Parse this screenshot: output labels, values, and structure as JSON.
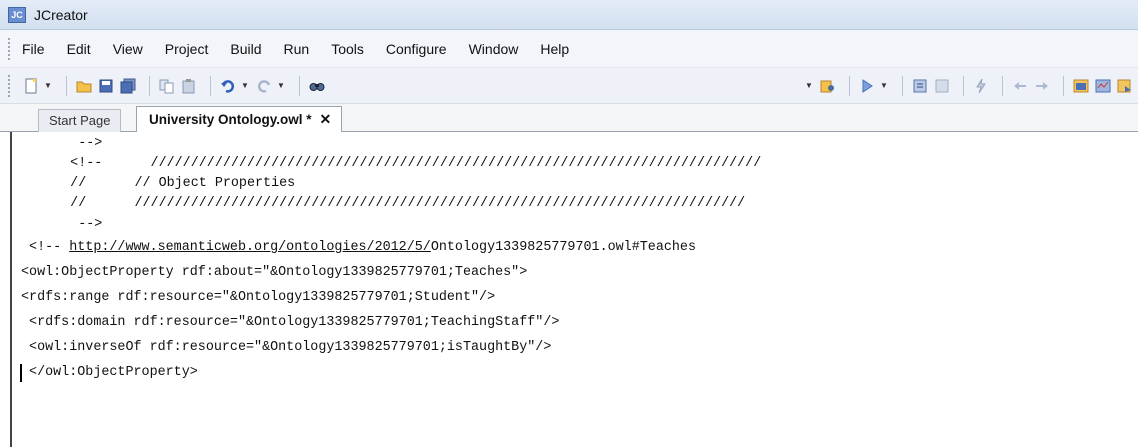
{
  "window": {
    "title": "JCreator"
  },
  "menu": {
    "items": [
      "File",
      "Edit",
      "View",
      "Project",
      "Build",
      "Run",
      "Tools",
      "Configure",
      "Window",
      "Help"
    ]
  },
  "toolbar": {
    "icons": [
      "new-file-icon",
      "open-folder-icon",
      "save-icon",
      "save-all-icon",
      "copy-icon",
      "paste-icon",
      "undo-icon",
      "redo-icon",
      "find-icon",
      "find-in-files-icon",
      "run-icon",
      "compile-icon",
      "build-icon",
      "debug-icon",
      "back-icon",
      "forward-icon",
      "window-icon"
    ]
  },
  "tabs": {
    "start": "Start Page",
    "active": "University Ontology.owl *",
    "close": "✕"
  },
  "editor": {
    "lines": [
      "      -->",
      "     <!--      ////////////////////////////////////////////////////////////////////////////",
      "     //      // Object Properties",
      "     //      ////////////////////////////////////////////////////////////////////////////",
      "      -->",
      "",
      "<owl:ObjectProperty rdf:about=\"&Ontology1339825779701;Teaches\">",
      "<rdfs:range rdf:resource=\"&Ontology1339825779701;Student\"/>",
      " <rdfs:domain rdf:resource=\"&Ontology1339825779701;TeachingStaff\"/>",
      " <owl:inverseOf rdf:resource=\"&Ontology1339825779701;isTaughtBy\"/>",
      " </owl:ObjectProperty>"
    ],
    "comment_prefix": " <!-- ",
    "comment_url": "http://www.semanticweb.org/ontologies/2012/5/",
    "comment_suffix": "Ontology1339825779701.owl#Teaches"
  },
  "colors": {
    "title_bg": "#d3e0f0",
    "menu_bg": "#f3f5fa",
    "toolbar_bg": "#eef2f8"
  }
}
